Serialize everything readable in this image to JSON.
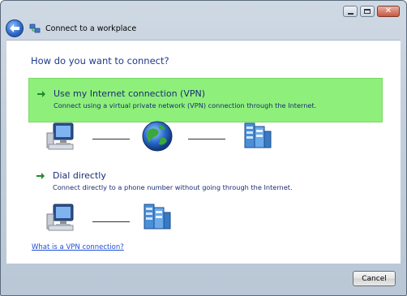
{
  "window": {
    "title": "Connect to a workplace"
  },
  "titlebar_buttons": {
    "minimize": "minimize-icon",
    "maximize": "maximize-icon",
    "close": "close-icon"
  },
  "main": {
    "question": "How do you want to connect?",
    "options": [
      {
        "title": "Use my Internet connection (VPN)",
        "description": "Connect using a virtual private network (VPN) connection through the Internet.",
        "highlighted": true
      },
      {
        "title": "Dial directly",
        "description": "Connect directly to a phone number without going through the Internet.",
        "highlighted": false
      }
    ],
    "help_link": "What is a VPN connection?"
  },
  "footer": {
    "cancel_label": "Cancel"
  },
  "colors": {
    "highlight": "#8ef07a",
    "link": "#1f4fd6",
    "heading": "#1e3a8a"
  }
}
